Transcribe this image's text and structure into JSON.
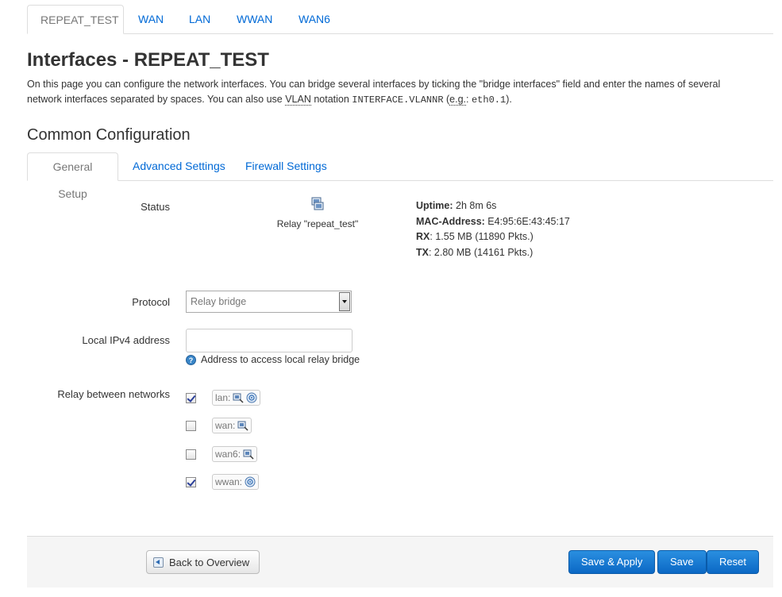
{
  "top_tabs": [
    {
      "label": "REPEAT_TEST",
      "active": true
    },
    {
      "label": "WAN",
      "active": false
    },
    {
      "label": "LAN",
      "active": false
    },
    {
      "label": "WWAN",
      "active": false
    },
    {
      "label": "WAN6",
      "active": false
    }
  ],
  "page": {
    "title": "Interfaces - REPEAT_TEST",
    "desc_part1": "On this page you can configure the network interfaces. You can bridge several interfaces by ticking the \"bridge interfaces\" field and enter the names of several network interfaces separated by spaces. You can also use ",
    "desc_vlan": "VLAN",
    "desc_part2": " notation ",
    "desc_code1": "INTERFACE.VLANNR",
    "desc_part3": " (",
    "desc_eg": "e.g.",
    "desc_part4": ": ",
    "desc_code2": "eth0.1",
    "desc_part5": ")."
  },
  "section": {
    "title": "Common Configuration"
  },
  "sub_tabs": [
    {
      "label": "General Setup",
      "active": true
    },
    {
      "label": "Advanced Settings",
      "active": false
    },
    {
      "label": "Firewall Settings",
      "active": false
    }
  ],
  "status": {
    "label": "Status",
    "icon": "network-interface-icon",
    "caption": "Relay \"repeat_test\"",
    "uptime_label": "Uptime:",
    "uptime_value": " 2h 8m 6s",
    "mac_label": "MAC-Address:",
    "mac_value": " E4:95:6E:43:45:17",
    "rx_label": "RX",
    "rx_value": ": 1.55 MB (11890 Pkts.)",
    "tx_label": "TX",
    "tx_value": ": 2.80 MB (14161 Pkts.)"
  },
  "protocol": {
    "label": "Protocol",
    "value": "Relay bridge"
  },
  "ipv4": {
    "label": "Local IPv4 address",
    "value": "",
    "hint": "Address to access local relay bridge"
  },
  "relay": {
    "label": "Relay between networks",
    "networks": [
      {
        "name": "lan:",
        "checked": true,
        "icons": [
          "ethernet-icon",
          "wireless-icon"
        ]
      },
      {
        "name": "wan:",
        "checked": false,
        "icons": [
          "ethernet-icon"
        ]
      },
      {
        "name": "wan6:",
        "checked": false,
        "icons": [
          "ethernet-icon"
        ]
      },
      {
        "name": "wwan:",
        "checked": true,
        "icons": [
          "wireless-icon"
        ]
      }
    ]
  },
  "footer": {
    "back_label": "Back to Overview",
    "save_apply_label": "Save & Apply",
    "save_label": "Save",
    "reset_label": "Reset"
  },
  "colors": {
    "link": "#0069d6",
    "primary_button": "#0b68c5",
    "footer_bg": "#f5f5f5"
  }
}
